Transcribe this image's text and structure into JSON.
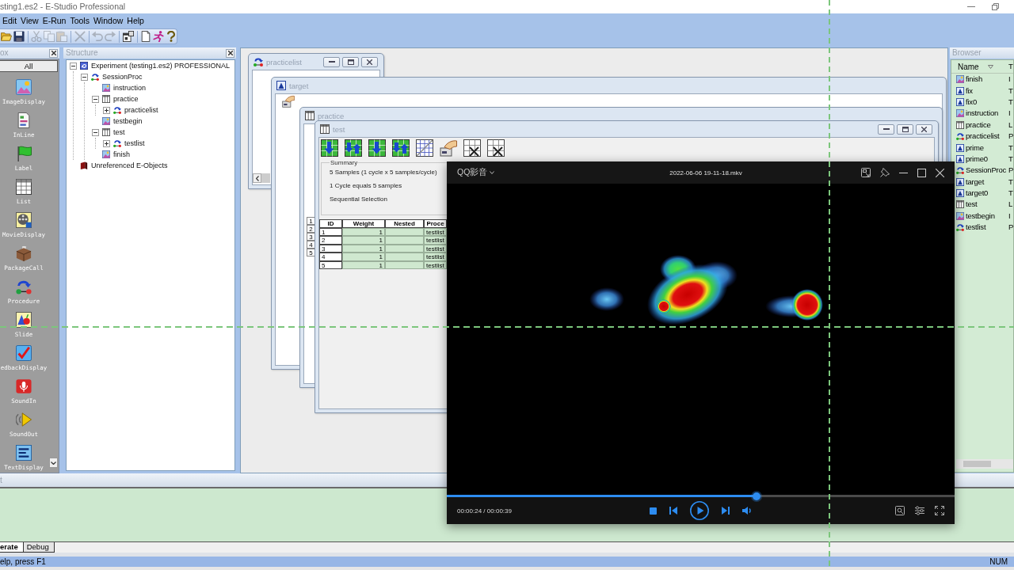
{
  "window": {
    "title": "sting1.es2 - E-Studio Professional"
  },
  "menu": [
    "Edit",
    "View",
    "E-Run",
    "Tools",
    "Window",
    "Help"
  ],
  "toolbar": [
    {
      "kind": "open",
      "disabled": false
    },
    {
      "kind": "save",
      "disabled": false
    },
    {
      "kind": "cut",
      "disabled": true
    },
    {
      "kind": "copy",
      "disabled": true
    },
    {
      "kind": "paste",
      "disabled": true
    },
    {
      "kind": "delete",
      "disabled": true
    },
    {
      "kind": "undo",
      "disabled": true
    },
    {
      "kind": "redo",
      "disabled": true
    },
    {
      "kind": "properties",
      "disabled": false
    },
    {
      "kind": "new",
      "disabled": false
    },
    {
      "kind": "run",
      "disabled": false
    },
    {
      "kind": "help",
      "disabled": false
    }
  ],
  "toolbox": {
    "title": "ox",
    "filter": "All",
    "items": [
      {
        "label": "ImageDisplay",
        "kind": "image"
      },
      {
        "label": "InLine",
        "kind": "inline"
      },
      {
        "label": "Label",
        "kind": "label"
      },
      {
        "label": "List",
        "kind": "list"
      },
      {
        "label": "MovieDisplay",
        "kind": "movie"
      },
      {
        "label": "PackageCall",
        "kind": "package"
      },
      {
        "label": "Procedure",
        "kind": "procedure"
      },
      {
        "label": "Slide",
        "kind": "slide"
      },
      {
        "label": "edbackDisplay",
        "kind": "feedback"
      },
      {
        "label": "SoundIn",
        "kind": "soundin"
      },
      {
        "label": "SoundOut",
        "kind": "soundout"
      },
      {
        "label": "TextDisplay",
        "kind": "text"
      }
    ]
  },
  "structure": {
    "title": "Structure",
    "tree": [
      {
        "label": "Experiment (testing1.es2) PROFESSIONAL",
        "kind": "experiment",
        "expanded": true,
        "children": [
          {
            "label": "SessionProc",
            "kind": "procedure",
            "expanded": true,
            "children": [
              {
                "label": "instruction",
                "kind": "display"
              },
              {
                "label": "practice",
                "kind": "list",
                "expanded": true,
                "children": [
                  {
                    "label": "practicelist",
                    "kind": "procedure",
                    "expanded": false
                  }
                ]
              },
              {
                "label": "testbegin",
                "kind": "display"
              },
              {
                "label": "test",
                "kind": "list",
                "expanded": true,
                "children": [
                  {
                    "label": "testlist",
                    "kind": "procedure",
                    "expanded": false
                  }
                ]
              },
              {
                "label": "finish",
                "kind": "display"
              }
            ]
          }
        ]
      },
      {
        "label": "Unreferenced E-Objects",
        "kind": "folder"
      }
    ]
  },
  "windows": [
    {
      "title": "practicelist",
      "kind": "procedure",
      "controls": true
    },
    {
      "title": "target",
      "kind": "text",
      "controls": false
    },
    {
      "title": "practice",
      "kind": "list",
      "controls": false,
      "row_numbers": [
        "1",
        "2",
        "3",
        "4",
        "5"
      ]
    },
    {
      "title": "test",
      "kind": "list",
      "controls": true,
      "summary": {
        "heading": "Summary",
        "lines": [
          "5 Samples (1 cycle x 5 samples/cycle)",
          "1 Cycle equals 5 samples",
          "Sequential Selection"
        ]
      },
      "table": {
        "columns": [
          "ID",
          "Weight",
          "Nested",
          "Proce"
        ],
        "rows": [
          {
            "id": "1",
            "weight": "1",
            "procedure": "testlist"
          },
          {
            "id": "2",
            "weight": "1",
            "procedure": "testlist"
          },
          {
            "id": "3",
            "weight": "1",
            "procedure": "testlist"
          },
          {
            "id": "4",
            "weight": "1",
            "procedure": "testlist"
          },
          {
            "id": "5",
            "weight": "1",
            "procedure": "testlist"
          }
        ]
      }
    }
  ],
  "browser": {
    "title": "Browser",
    "columns": [
      "Name",
      "T"
    ],
    "rows": [
      {
        "name": "finish",
        "type": "I",
        "kind": "display"
      },
      {
        "name": "fix",
        "type": "T",
        "kind": "text"
      },
      {
        "name": "fix0",
        "type": "T",
        "kind": "text"
      },
      {
        "name": "instruction",
        "type": "I",
        "kind": "display"
      },
      {
        "name": "practice",
        "type": "L",
        "kind": "list"
      },
      {
        "name": "practicelist",
        "type": "P",
        "kind": "procedure"
      },
      {
        "name": "prime",
        "type": "T",
        "kind": "text"
      },
      {
        "name": "prime0",
        "type": "T",
        "kind": "text"
      },
      {
        "name": "SessionProc",
        "type": "P",
        "kind": "procedure"
      },
      {
        "name": "target",
        "type": "T",
        "kind": "text"
      },
      {
        "name": "target0",
        "type": "T",
        "kind": "text"
      },
      {
        "name": "test",
        "type": "L",
        "kind": "list"
      },
      {
        "name": "testbegin",
        "type": "I",
        "kind": "display"
      },
      {
        "name": "testlist",
        "type": "P",
        "kind": "procedure"
      }
    ]
  },
  "player": {
    "app_name": "QQ影音",
    "title": "2022-06-06 19-11-18.mkv",
    "progress": {
      "level": 0.61
    },
    "time": "00:00:24 / 00:00:39"
  },
  "output": {
    "title": "t",
    "tabs": [
      {
        "label": "erate",
        "selected": true
      },
      {
        "label": "Debug",
        "selected": false
      }
    ]
  },
  "status_bar": {
    "message": "elp, press F1",
    "indicator": "NUM"
  }
}
